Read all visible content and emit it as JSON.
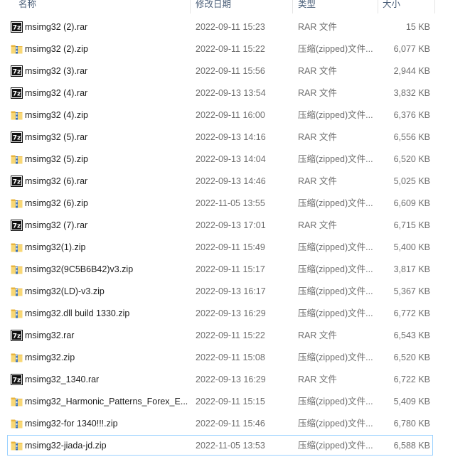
{
  "columns": {
    "name": "名称",
    "date": "修改日期",
    "type": "类型",
    "size": "大小"
  },
  "files": [
    {
      "name": "msimg32 (2).rar",
      "date": "2022-09-11 15:23",
      "type": "RAR 文件",
      "size": "15 KB",
      "icon": "rar-archive-icon"
    },
    {
      "name": "msimg32 (2).zip",
      "date": "2022-09-11 15:22",
      "type": "压缩(zipped)文件...",
      "size": "6,077 KB",
      "icon": "zip-folder-icon"
    },
    {
      "name": "msimg32 (3).rar",
      "date": "2022-09-11 15:56",
      "type": "RAR 文件",
      "size": "2,944 KB",
      "icon": "rar-archive-icon"
    },
    {
      "name": "msimg32 (4).rar",
      "date": "2022-09-13 13:54",
      "type": "RAR 文件",
      "size": "3,832 KB",
      "icon": "rar-archive-icon"
    },
    {
      "name": "msimg32 (4).zip",
      "date": "2022-09-11 16:00",
      "type": "压缩(zipped)文件...",
      "size": "6,376 KB",
      "icon": "zip-folder-icon"
    },
    {
      "name": "msimg32 (5).rar",
      "date": "2022-09-13 14:16",
      "type": "RAR 文件",
      "size": "6,556 KB",
      "icon": "rar-archive-icon"
    },
    {
      "name": "msimg32 (5).zip",
      "date": "2022-09-13 14:04",
      "type": "压缩(zipped)文件...",
      "size": "6,520 KB",
      "icon": "zip-folder-icon"
    },
    {
      "name": "msimg32 (6).rar",
      "date": "2022-09-13 14:46",
      "type": "RAR 文件",
      "size": "5,025 KB",
      "icon": "rar-archive-icon"
    },
    {
      "name": "msimg32 (6).zip",
      "date": "2022-11-05 13:55",
      "type": "压缩(zipped)文件...",
      "size": "6,609 KB",
      "icon": "zip-folder-icon"
    },
    {
      "name": "msimg32 (7).rar",
      "date": "2022-09-13 17:01",
      "type": "RAR 文件",
      "size": "6,715 KB",
      "icon": "rar-archive-icon"
    },
    {
      "name": "msimg32(1).zip",
      "date": "2022-09-11 15:49",
      "type": "压缩(zipped)文件...",
      "size": "5,400 KB",
      "icon": "zip-folder-icon"
    },
    {
      "name": "msimg32(9C5B6B42)v3.zip",
      "date": "2022-09-11 15:17",
      "type": "压缩(zipped)文件...",
      "size": "3,817 KB",
      "icon": "zip-folder-icon"
    },
    {
      "name": "msimg32(LD)-v3.zip",
      "date": "2022-09-13 16:17",
      "type": "压缩(zipped)文件...",
      "size": "5,367 KB",
      "icon": "zip-folder-icon"
    },
    {
      "name": "msimg32.dll build 1330.zip",
      "date": "2022-09-13 16:29",
      "type": "压缩(zipped)文件...",
      "size": "6,772 KB",
      "icon": "zip-folder-icon"
    },
    {
      "name": "msimg32.rar",
      "date": "2022-09-11 15:22",
      "type": "RAR 文件",
      "size": "6,543 KB",
      "icon": "rar-archive-icon"
    },
    {
      "name": "msimg32.zip",
      "date": "2022-09-11 15:08",
      "type": "压缩(zipped)文件...",
      "size": "6,520 KB",
      "icon": "zip-folder-icon"
    },
    {
      "name": "msimg32_1340.rar",
      "date": "2022-09-13 16:29",
      "type": "RAR 文件",
      "size": "6,722 KB",
      "icon": "rar-archive-icon"
    },
    {
      "name": "msimg32_Harmonic_Patterns_Forex_E...",
      "date": "2022-09-11 15:15",
      "type": "压缩(zipped)文件...",
      "size": "5,409 KB",
      "icon": "zip-folder-icon"
    },
    {
      "name": "msimg32-for 1340!!!.zip",
      "date": "2022-09-11 15:46",
      "type": "压缩(zipped)文件...",
      "size": "6,780 KB",
      "icon": "zip-folder-icon"
    },
    {
      "name": "msimg32-jiada-jd.zip",
      "date": "2022-11-05 13:53",
      "type": "压缩(zipped)文件...",
      "size": "6,588 KB",
      "icon": "zip-folder-icon",
      "focused": true
    }
  ]
}
